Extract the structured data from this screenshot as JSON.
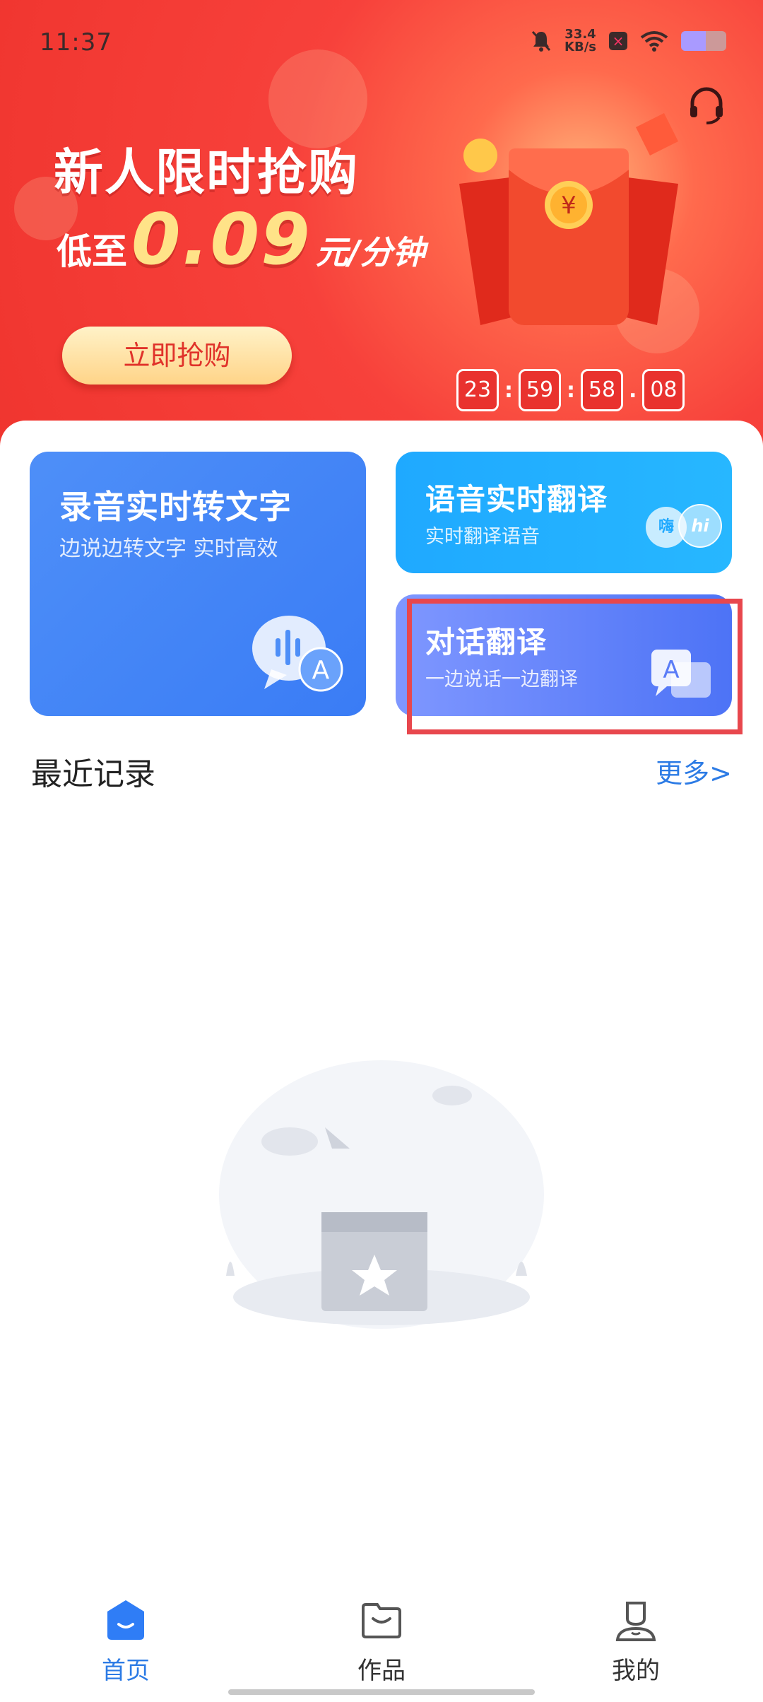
{
  "status_bar": {
    "time": "11:37",
    "net_speed_value": "33.4",
    "net_speed_unit": "KB/s"
  },
  "promo": {
    "title": "新人限时抢购",
    "sub_pre": "低至",
    "price": "0.09",
    "price_unit": "元/分钟",
    "buy_button": "立即抢购",
    "countdown": [
      "23",
      "59",
      "58",
      "08"
    ],
    "countdown_seps": [
      ":",
      ":",
      "."
    ]
  },
  "cards": {
    "record": {
      "title": "录音实时转文字",
      "subtitle": "边说边转文字 实时高效"
    },
    "voice_translate": {
      "title": "语音实时翻译",
      "subtitle": "实时翻译语音",
      "badge_left": "嗨",
      "badge_right": "hi"
    },
    "dialog_translate": {
      "title": "对话翻译",
      "subtitle": "一边说话一边翻译"
    }
  },
  "recent": {
    "title": "最近记录",
    "more": "更多>"
  },
  "tabbar": {
    "home": "首页",
    "works": "作品",
    "mine": "我的"
  },
  "colors": {
    "accent_blue": "#2c7be5",
    "banner_red": "#f0352f",
    "highlight_red": "#e8474d"
  }
}
